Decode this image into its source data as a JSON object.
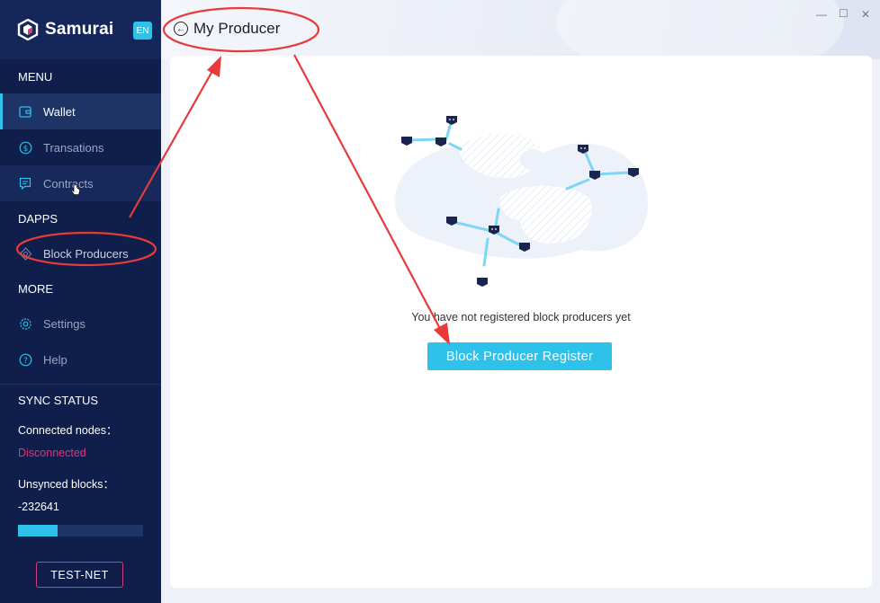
{
  "brand": {
    "name": "Samurai",
    "lang": "EN"
  },
  "menu": {
    "title": "MENU",
    "items": [
      {
        "label": "Wallet",
        "icon": "wallet-icon"
      },
      {
        "label": "Transations",
        "icon": "dollar-icon"
      },
      {
        "label": "Contracts",
        "icon": "contract-icon"
      }
    ]
  },
  "dapps": {
    "title": "DAPPS",
    "items": [
      {
        "label": "Block Producers",
        "icon": "block-producer-icon"
      }
    ]
  },
  "more": {
    "title": "MORE",
    "items": [
      {
        "label": "Settings",
        "icon": "gear-icon"
      },
      {
        "label": "Help",
        "icon": "help-icon"
      }
    ]
  },
  "sync": {
    "title": "SYNC STATUS",
    "connected_label": "Connected nodes：",
    "connected_value": "Disconnected",
    "unsynced_label": "Unsynced blocks：",
    "unsynced_value": "-232641",
    "progress_fraction": 0.32
  },
  "network": "TEST-NET",
  "header": {
    "title": "My Producer"
  },
  "window_controls": [
    "—",
    "☐",
    "✕"
  ],
  "main": {
    "empty_message": "You have not registered block producers yet",
    "register_button": "Block Producer Register"
  },
  "colors": {
    "accent": "#2ec1ea",
    "sidebar": "#0f1e4a",
    "error": "#e8327a",
    "annotation": "#e83a3a"
  }
}
